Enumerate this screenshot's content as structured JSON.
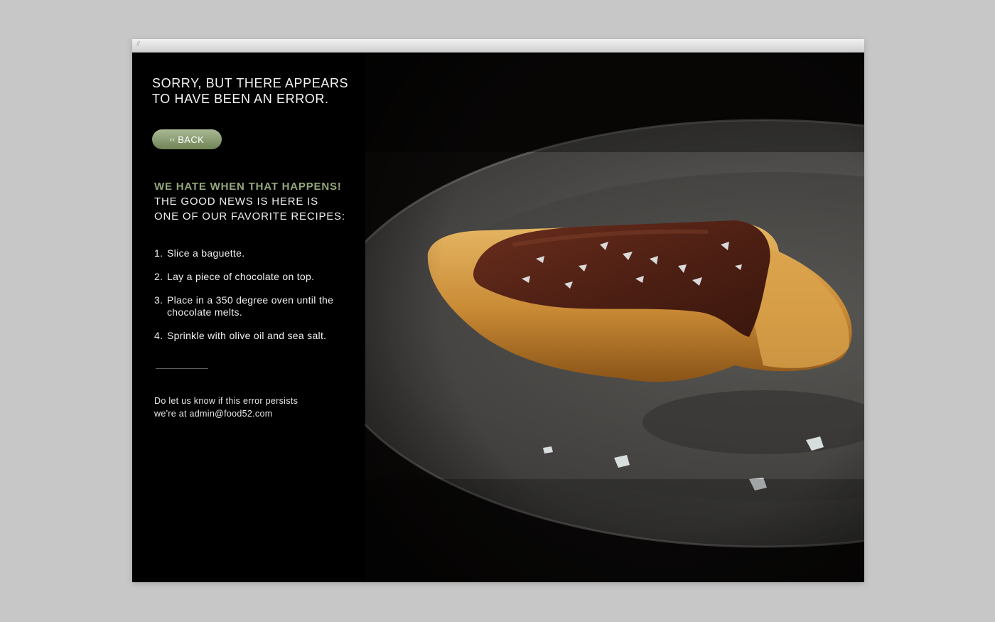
{
  "error_page": {
    "headline": "SORRY, BUT THERE APPEARS TO HAVE BEEN AN ERROR.",
    "back_button": {
      "icon": "double-chevron-left-icon",
      "label": "BACK"
    },
    "subhead": {
      "accent": "WE HATE WHEN THAT HAPPENS!",
      "line1": "THE GOOD NEWS IS HERE IS",
      "line2": "ONE OF OUR FAVORITE RECIPES:"
    },
    "recipe_steps": [
      {
        "num": "1.",
        "text": "Slice a baguette."
      },
      {
        "num": "2.",
        "text": "Lay a piece of chocolate on top."
      },
      {
        "num": "3.",
        "text": "Place in a 350 degree oven until the chocolate melts."
      },
      {
        "num": "4.",
        "text": "Sprinkle with olive oil and sea salt."
      }
    ],
    "contact": {
      "line1": "Do let us know if this error persists",
      "line2": "we're at admin@food52.com"
    }
  },
  "colors": {
    "accent_green": "#94a87c",
    "panel_background": "#000000",
    "page_background": "#c7c7c7"
  }
}
